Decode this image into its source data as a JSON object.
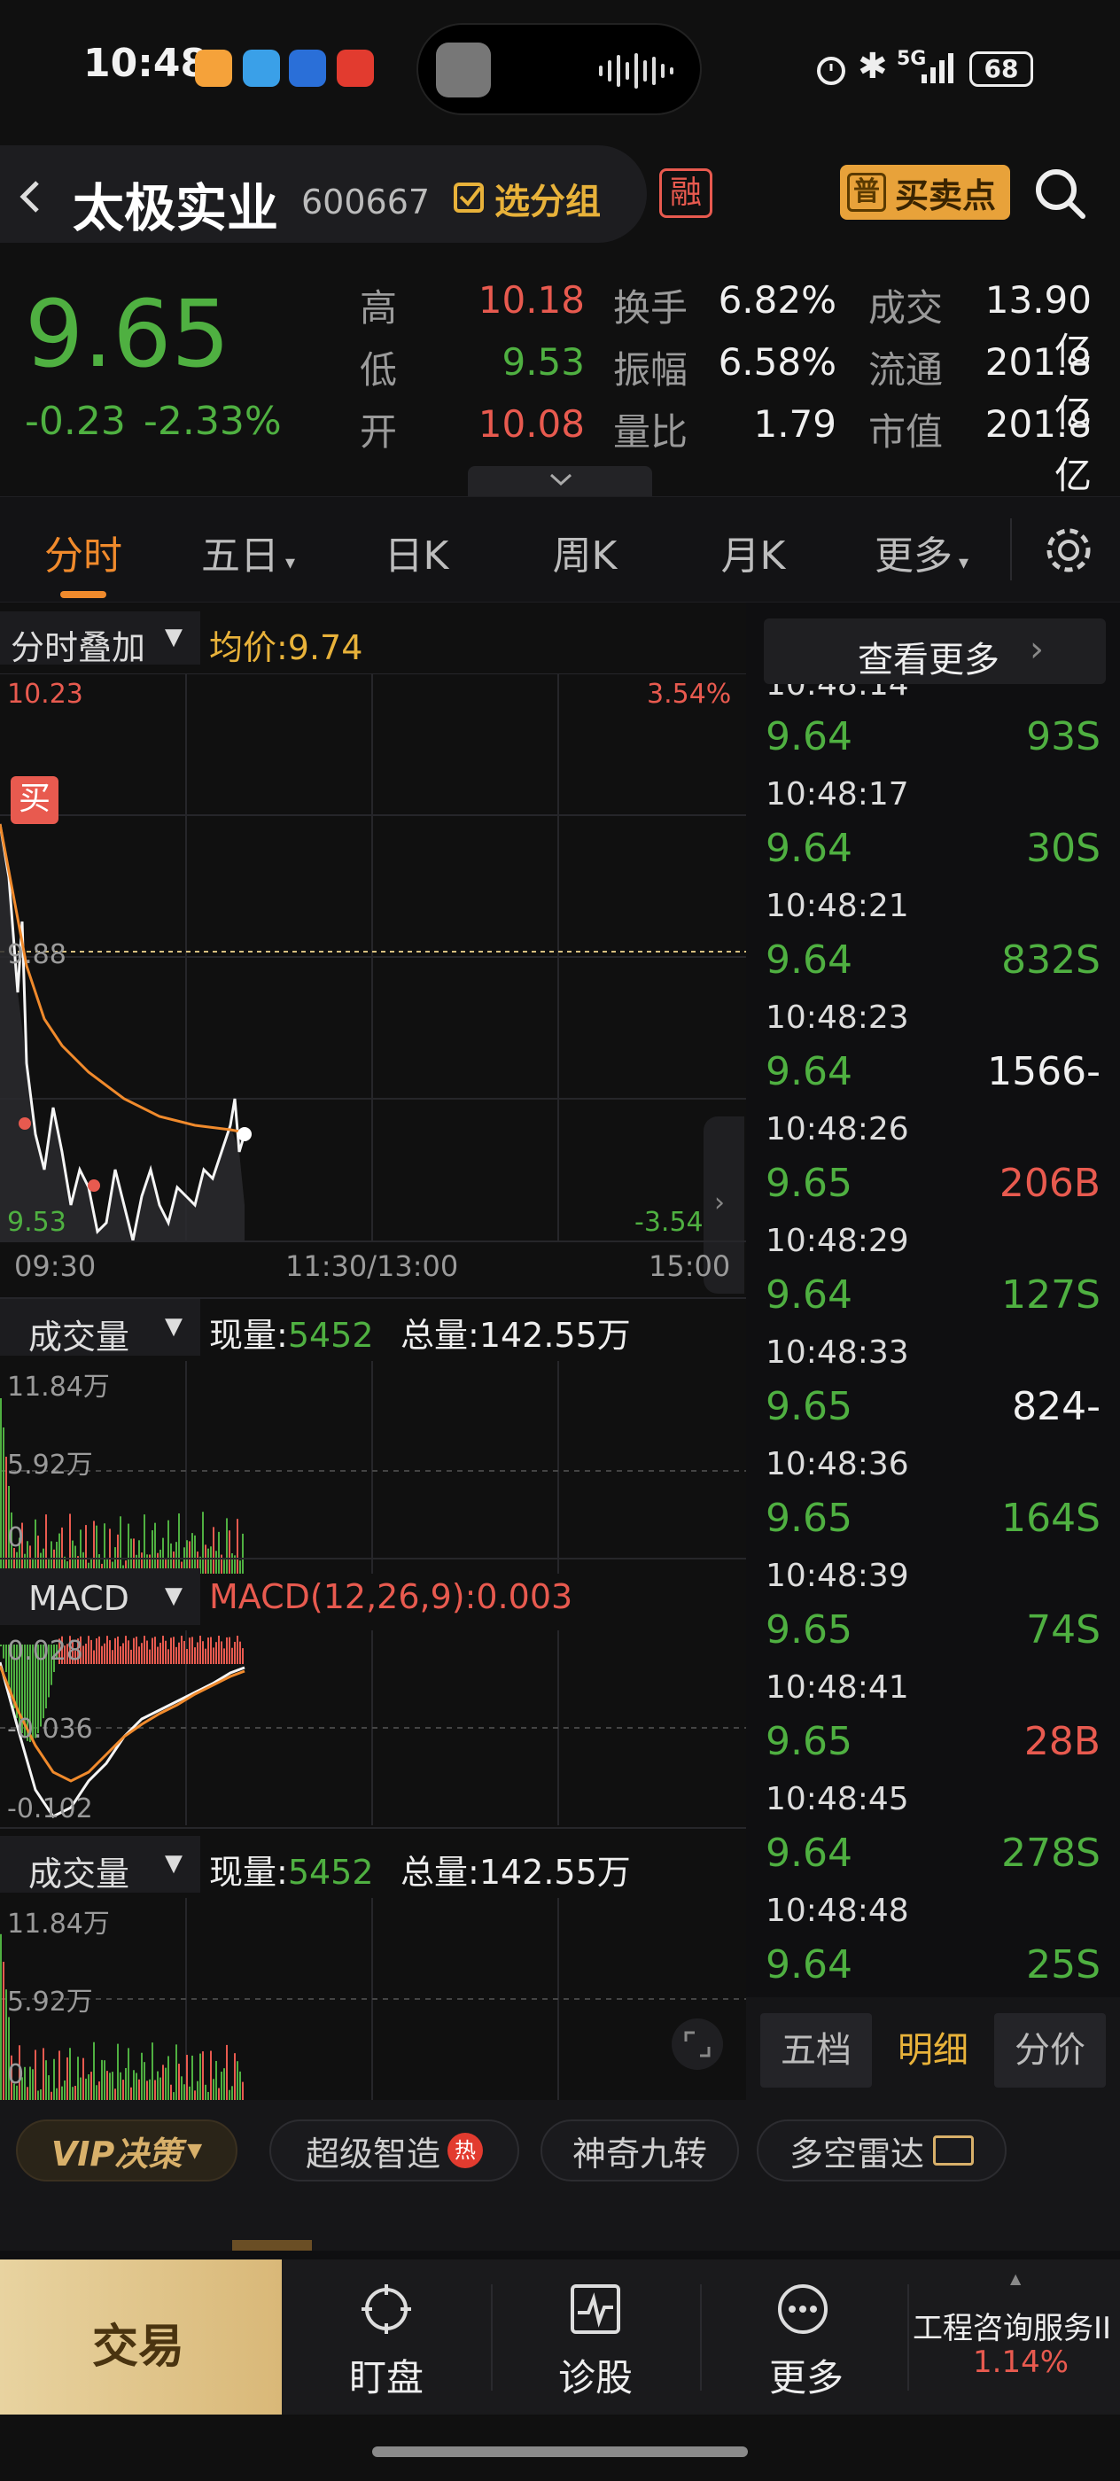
{
  "status_bar": {
    "time": "10:48",
    "battery": "68",
    "network": "5G"
  },
  "header": {
    "back_icon": "chevron-left-icon",
    "stock_name": "太极实业",
    "stock_code": "600667",
    "group_label": "选分组",
    "margin_badge": "融",
    "buy_sell_badge": "普",
    "buy_sell_label": "买卖点",
    "search_icon": "search-icon"
  },
  "quote": {
    "price": "9.65",
    "change": "-0.23",
    "change_pct": "-2.33%",
    "rows": [
      {
        "l1": "高",
        "v1": "10.18",
        "l2": "换手",
        "v2": "6.82%",
        "l3": "成交",
        "v3": "13.90亿"
      },
      {
        "l1": "低",
        "v1": "9.53",
        "l2": "振幅",
        "v2": "6.58%",
        "l3": "流通",
        "v3": "201.8亿"
      },
      {
        "l1": "开",
        "v1": "10.08",
        "l2": "量比",
        "v2": "1.79",
        "l3": "市值",
        "v3": "201.8亿"
      }
    ]
  },
  "tabs": [
    "分时",
    "五日",
    "日K",
    "周K",
    "月K",
    "更多"
  ],
  "tabs_active": "分时",
  "intraday": {
    "overlay_label": "分时叠加",
    "avg_label": "均价:9.74",
    "y_top": "10.23",
    "y_top_pct": "3.54%",
    "y_bottom": "9.53",
    "y_bottom_pct": "-3.54%",
    "prev_close": "9.88",
    "buy_marker": "买",
    "x_labels": [
      "09:30",
      "11:30/13:00",
      "15:00"
    ]
  },
  "volume1": {
    "label": "成交量",
    "now_label": "现量:",
    "now_value": "5452",
    "total_label": "总量:",
    "total_value": "142.55万",
    "y_top": "11.84万",
    "y_mid": "5.92万",
    "y_bottom": "0"
  },
  "macd": {
    "label": "MACD",
    "params_label": "MACD(12,26,9):0.003",
    "y_top": "0.028",
    "y_mid": "-0.036",
    "y_bottom": "-0.102"
  },
  "volume2": {
    "label": "成交量",
    "now_label": "现量:",
    "now_value": "5452",
    "total_label": "总量:",
    "total_value": "142.55万",
    "y_top": "11.84万",
    "y_mid": "5.92万",
    "y_bottom": "0"
  },
  "ticks": {
    "more_label": "查看更多",
    "partial_time": "10:48:14",
    "items": [
      {
        "price": "9.64",
        "vol": "93S",
        "color": "green"
      },
      {
        "time": "10:48:17",
        "price": "9.64",
        "vol": "30S",
        "color": "green"
      },
      {
        "time": "10:48:21",
        "price": "9.64",
        "vol": "832S",
        "color": "green"
      },
      {
        "time": "10:48:23",
        "price": "9.64",
        "vol": "1566-",
        "color": "white"
      },
      {
        "time": "10:48:26",
        "price": "9.65",
        "vol": "206B",
        "color": "red"
      },
      {
        "time": "10:48:29",
        "price": "9.64",
        "vol": "127S",
        "color": "green"
      },
      {
        "time": "10:48:33",
        "price": "9.65",
        "vol": "824-",
        "color": "white"
      },
      {
        "time": "10:48:36",
        "price": "9.65",
        "vol": "164S",
        "color": "green"
      },
      {
        "time": "10:48:39",
        "price": "9.65",
        "vol": "74S",
        "color": "green"
      },
      {
        "time": "10:48:41",
        "price": "9.65",
        "vol": "28B",
        "color": "red"
      },
      {
        "time": "10:48:45",
        "price": "9.64",
        "vol": "278S",
        "color": "green"
      },
      {
        "time": "10:48:48",
        "price": "9.64",
        "vol": "25S",
        "color": "green"
      }
    ],
    "bottom_tabs": [
      "五档",
      "明细",
      "分价"
    ],
    "bottom_active": "明细"
  },
  "strip": {
    "vip": "VIP决策",
    "items": [
      "超级智造",
      "神奇九转",
      "多空雷达"
    ],
    "hot_badge": "热"
  },
  "nav": {
    "trade": "交易",
    "items": [
      "盯盘",
      "诊股",
      "更多"
    ],
    "sector_name": "工程咨询服务II",
    "sector_pct": "1.14%"
  },
  "colors": {
    "up": "#e85a4f",
    "down": "#4fb041",
    "accent": "#f08a2c",
    "gold": "#e8b23a"
  }
}
